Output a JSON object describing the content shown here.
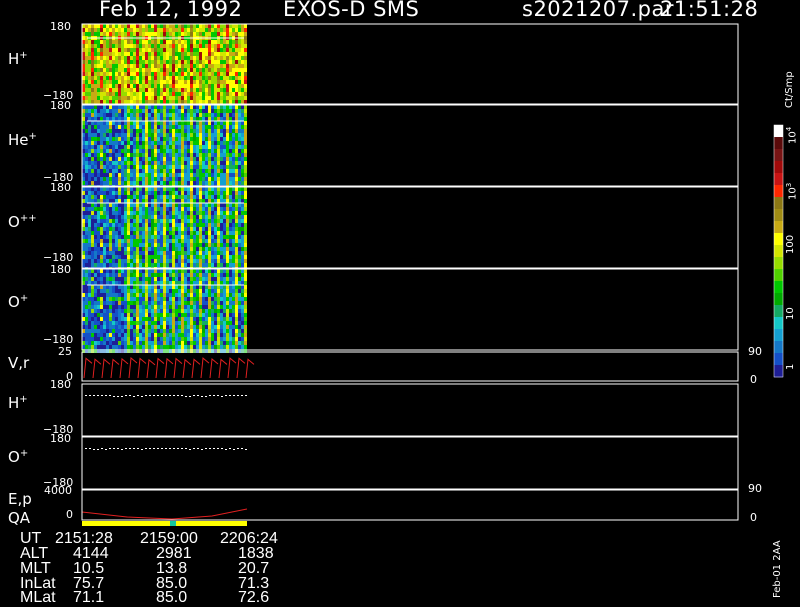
{
  "header": {
    "date": "Feb 12, 1992",
    "mission": "EXOS-D SMS",
    "file": "s2021207.par",
    "time": "21:51:28"
  },
  "colorbar": {
    "unit": "Ct/Smp",
    "ticks": [
      "1",
      "10",
      "100",
      "10",
      "10"
    ],
    "tick_sup": [
      "",
      "",
      "",
      "3",
      "4"
    ],
    "colors": [
      "#1e1e96",
      "#1450c8",
      "#1478c8",
      "#14a0d2",
      "#14c8c8",
      "#14aa64",
      "#00aa00",
      "#00c800",
      "#50d200",
      "#96dc00",
      "#d2e600",
      "#ffff00",
      "#c8aa14",
      "#a08c14",
      "#8c7814",
      "#ff2800",
      "#c81414",
      "#a00a0a",
      "#781414",
      "#5a0a0a",
      "#ffffff"
    ]
  },
  "panels": [
    {
      "label": "H",
      "sup": "+",
      "ymax": "180",
      "ymin": "−180"
    },
    {
      "label": "He",
      "sup": "+",
      "ymax": "180",
      "ymin": "−180"
    },
    {
      "label": "O",
      "sup": "++",
      "ymax": "180",
      "ymin": "−180"
    },
    {
      "label": "O",
      "sup": "+",
      "ymax": "180",
      "ymin": "−180"
    },
    {
      "label": "V,r",
      "sup": "",
      "ymax": "25",
      "ymin": "0",
      "rmax": "90",
      "rmin": "0"
    },
    {
      "label": "H",
      "sup": "+",
      "ymax": "180",
      "ymin": "−180"
    },
    {
      "label": "O",
      "sup": "+",
      "ymax": "180",
      "ymin": "−180"
    },
    {
      "label": "E,p",
      "sup": "",
      "ymax": "4000",
      "ymin": "0",
      "rmax": "90",
      "rmin": "0"
    }
  ],
  "qa_label": "QA",
  "footer": {
    "rows": [
      {
        "name": "UT",
        "values": [
          "2151:28",
          "2159:00",
          "2206:24"
        ]
      },
      {
        "name": "ALT",
        "values": [
          "4144",
          "2981",
          "1838"
        ]
      },
      {
        "name": "MLT",
        "values": [
          "10.5",
          "13.8",
          "20.7"
        ]
      },
      {
        "name": "InLat",
        "values": [
          "75.7",
          "85.0",
          "71.3"
        ]
      },
      {
        "name": "MLat",
        "values": [
          "71.1",
          "85.0",
          "72.6"
        ]
      }
    ],
    "stamp": "Feb-01 2AA"
  },
  "chart_data": {
    "type": "heatmap",
    "title": "Feb 12, 1992   EXOS-D SMS",
    "xlabel": "UT",
    "x_ticks": [
      "2151:28",
      "2159:00",
      "2206:24"
    ],
    "series": [
      {
        "name": "H+",
        "ylim": [
          -180,
          180
        ]
      },
      {
        "name": "He+",
        "ylim": [
          -180,
          180
        ]
      },
      {
        "name": "O++",
        "ylim": [
          -180,
          180
        ]
      },
      {
        "name": "O+",
        "ylim": [
          -180,
          180
        ]
      },
      {
        "name": "V,r",
        "ylim": [
          0,
          25
        ],
        "y2lim": [
          0,
          90
        ]
      },
      {
        "name": "H+",
        "ylim": [
          -180,
          180
        ]
      },
      {
        "name": "O+",
        "ylim": [
          -180,
          180
        ]
      },
      {
        "name": "E,p",
        "ylim": [
          0,
          4000
        ],
        "y2lim": [
          0,
          90
        ]
      }
    ],
    "colorscale": {
      "unit": "Ct/Smp",
      "range": [
        1,
        10000
      ],
      "scale": "log"
    },
    "grid": false,
    "legend": "right"
  }
}
